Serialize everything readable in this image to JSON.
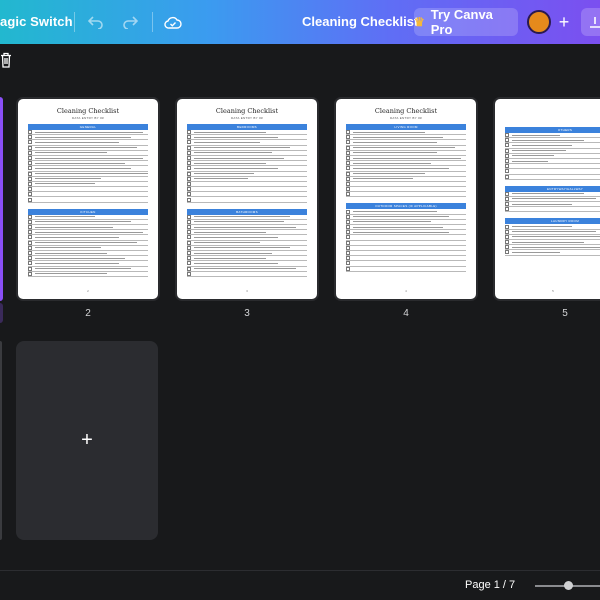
{
  "header": {
    "magic_switch_label": "agic Switch",
    "doc_title": "Cleaning Checklist",
    "try_pro_label": "Try Canva Pro",
    "crown_glyph": "♛",
    "plus_glyph": "+",
    "undo_glyph": "↶",
    "redo_glyph": "↷"
  },
  "pages": [
    {
      "number": "2",
      "title": "Cleaning Checklist",
      "subtitle": "DATA ENTRY BY ##",
      "sections": [
        {
          "name": "GENERAL",
          "rows": [
            0.9,
            0.8,
            0.7,
            0.85,
            0.6,
            0.9,
            0.75,
            0.8,
            0.95,
            0.55,
            0.5,
            0,
            0,
            0
          ]
        },
        {
          "name": "KITCHEN",
          "rows": [
            0.5,
            0.8,
            0.65,
            0.9,
            0.7,
            0.85,
            0.55,
            0.6,
            0.75,
            0.7,
            0.8,
            0.6
          ]
        }
      ],
      "footer": "2"
    },
    {
      "number": "3",
      "title": "Cleaning Checklist",
      "subtitle": "DATA ENTRY BY ##",
      "sections": [
        {
          "name": "BEDROOMS",
          "rows": [
            0.6,
            0.7,
            0.55,
            0.8,
            0.65,
            0.75,
            0.6,
            0.7,
            0.5,
            0.45,
            0,
            0,
            0,
            0
          ]
        },
        {
          "name": "BATHROOMS",
          "rows": [
            0.8,
            0.75,
            0.85,
            0.6,
            0.7,
            0.55,
            0.8,
            0.65,
            0.6,
            0.7,
            0.85,
            0
          ]
        }
      ],
      "footer": "3"
    },
    {
      "number": "4",
      "title": "Cleaning Checklist",
      "subtitle": "DATA ENTRY BY ##",
      "sections": [
        {
          "name": "LIVING ROOM",
          "rows": [
            0.6,
            0.75,
            0.7,
            0.85,
            0.7,
            0.9,
            0.65,
            0.8,
            0.6,
            0.5,
            0,
            0,
            0
          ]
        },
        {
          "name": "OUTDOOR SPACES (IF APPLICABLE)",
          "rows": [
            0.7,
            0.8,
            0.65,
            0.75,
            0.8,
            0,
            0,
            0,
            0,
            0,
            0,
            0
          ]
        }
      ],
      "footer": "4"
    },
    {
      "number": "5",
      "title": "",
      "subtitle": "",
      "sections": [
        {
          "name": "OTHERS",
          "rows": [
            0.4,
            0.6,
            0.5,
            0.45,
            0.35,
            0.3,
            0,
            0,
            0
          ]
        },
        {
          "name": "ENTRYWAY/HALLWAY",
          "rows": [
            0.6,
            0.7,
            0.5,
            0
          ]
        },
        {
          "name": "LAUNDRY ROOM",
          "rows": [
            0.5,
            0.7,
            0.75,
            0.6,
            0.8,
            0.4
          ]
        }
      ],
      "footer": "5"
    }
  ],
  "add_page_glyph": "+",
  "footer": {
    "page_indicator": "Page 1 / 7",
    "zoom_fraction": 0.5
  },
  "colors": {
    "section_bar": "#3b82dc",
    "selected_border": "#8a4ff7",
    "avatar": "#e58a1c"
  }
}
